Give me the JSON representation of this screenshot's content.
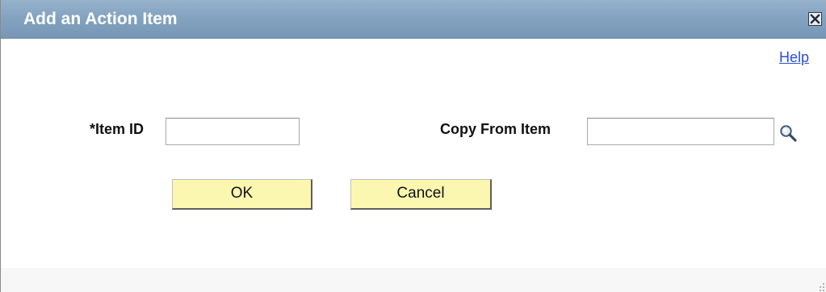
{
  "dialog": {
    "title": "Add an Action Item",
    "close_icon": "close-icon"
  },
  "help": {
    "label": "Help"
  },
  "form": {
    "item_id": {
      "label": "*Item ID",
      "value": ""
    },
    "copy_from_item": {
      "label": "Copy From Item",
      "value": "",
      "lookup_icon": "magnifier-lookup-icon"
    }
  },
  "buttons": {
    "ok": "OK",
    "cancel": "Cancel"
  },
  "colors": {
    "titlebar": "#84a3c1",
    "button_fill": "#fbf7b0",
    "link": "#2a4fd6"
  }
}
